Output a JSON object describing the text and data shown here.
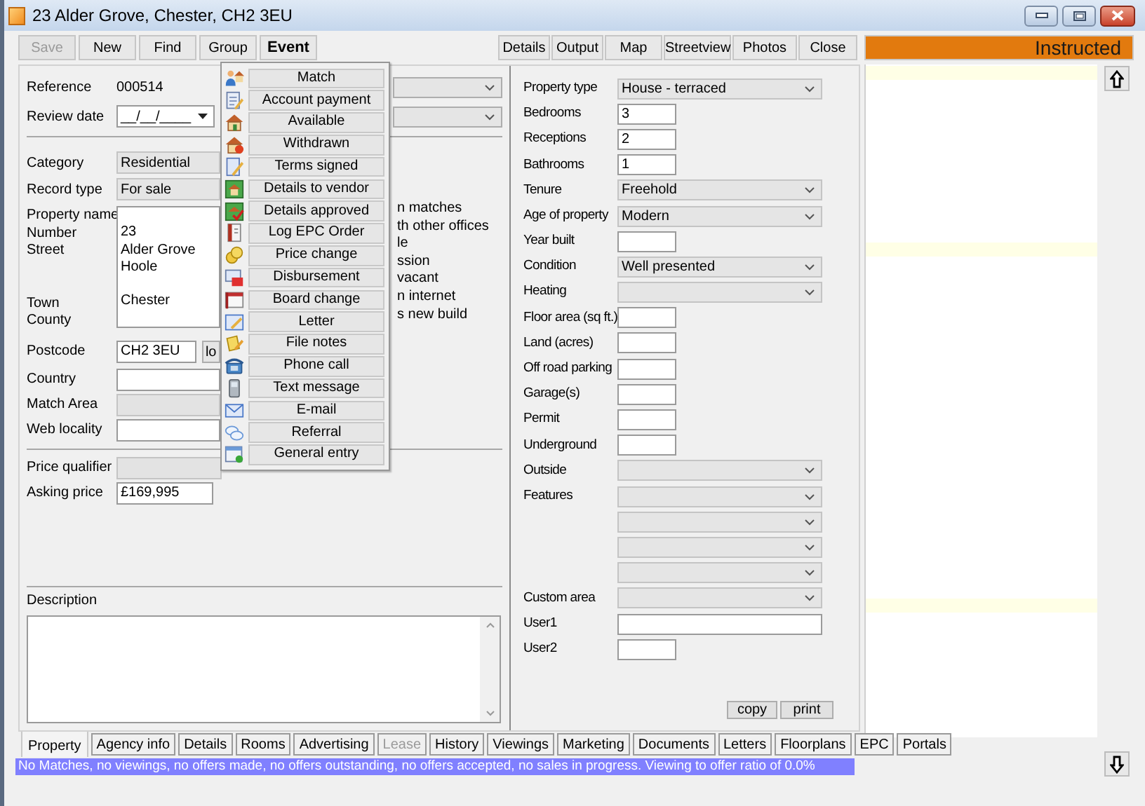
{
  "window": {
    "title": "23 Alder Grove, Chester, CH2 3EU"
  },
  "toolbar": [
    {
      "label": "Save",
      "disabled": true,
      "selected": false
    },
    {
      "label": "New",
      "disabled": false,
      "selected": false
    },
    {
      "label": "Find",
      "disabled": false,
      "selected": false
    },
    {
      "label": "Group",
      "disabled": false,
      "selected": false
    },
    {
      "label": "Event",
      "disabled": false,
      "selected": true
    }
  ],
  "view_buttons": [
    "Details",
    "Output",
    "Map",
    "Streetview",
    "Photos",
    "Close"
  ],
  "status_badge": "Instructed",
  "event_menu": [
    "Match",
    "Account payment",
    "Available",
    "Withdrawn",
    "Terms signed",
    "Details to vendor",
    "Details approved",
    "Log EPC Order",
    "Price change",
    "Disbursement",
    "Board change",
    "Letter",
    "File notes",
    "Phone call",
    "Text message",
    "E-mail",
    "Referral",
    "General entry"
  ],
  "record": {
    "reference": {
      "label": "Reference",
      "value": "000514"
    },
    "review_date": {
      "label": "Review date",
      "value": "__/__/____"
    },
    "category": {
      "label": "Category",
      "value": "Residential"
    },
    "record_type": {
      "label": "Record type",
      "value": "For sale"
    },
    "address": [
      {
        "label": "Property name"
      },
      {
        "label": "Number",
        "value": "23"
      },
      {
        "label": "Street",
        "value": "Alder Grove"
      },
      {
        "value": "Hoole"
      },
      {
        "label": "Town",
        "value": "Chester",
        "gap_before": true
      },
      {
        "label": "County"
      }
    ],
    "postcode": {
      "label": "Postcode",
      "value": "CH2 3EU",
      "button": "lo"
    },
    "country": {
      "label": "Country"
    },
    "match_area": {
      "label": "Match Area",
      "disabled": true
    },
    "web_locality": {
      "label": "Web locality"
    },
    "price_qualifier": {
      "label": "Price qualifier",
      "disabled": true
    },
    "asking_price": {
      "label": "Asking price",
      "value": "£169,995"
    },
    "description": {
      "label": "Description"
    }
  },
  "options_partial": [
    "n matches",
    "th other offices",
    "le",
    "ssion",
    "vacant",
    "n internet",
    "s new build"
  ],
  "details": [
    {
      "kind": "select",
      "label": "Property type",
      "value": "House - terraced"
    },
    {
      "kind": "input",
      "label": "Bedrooms",
      "value": "3"
    },
    {
      "kind": "input",
      "label": "Receptions",
      "value": "2"
    },
    {
      "kind": "input",
      "label": "Bathrooms",
      "value": "1"
    },
    {
      "kind": "select",
      "label": "Tenure",
      "value": "Freehold"
    },
    {
      "kind": "select",
      "label": "Age of property",
      "value": "Modern"
    },
    {
      "kind": "input",
      "label": "Year built"
    },
    {
      "kind": "select",
      "label": "Condition",
      "value": "Well presented"
    },
    {
      "kind": "select",
      "label": "Heating"
    },
    {
      "kind": "input",
      "label": "Floor area (sq ft.)"
    },
    {
      "kind": "input",
      "label": "Land (acres)"
    },
    {
      "kind": "input",
      "label": "Off road parking"
    },
    {
      "kind": "input",
      "label": "Garage(s)"
    },
    {
      "kind": "input",
      "label": "Permit"
    },
    {
      "kind": "input",
      "label": "Underground"
    },
    {
      "kind": "select",
      "label": "Outside"
    },
    {
      "kind": "select",
      "label": "Features"
    },
    {
      "kind": "select"
    },
    {
      "kind": "select"
    },
    {
      "kind": "select"
    },
    {
      "kind": "select",
      "label": "Custom area"
    },
    {
      "kind": "wide_input",
      "label": "User1"
    },
    {
      "kind": "input",
      "label": "User2"
    }
  ],
  "detail_buttons": [
    "copy",
    "print"
  ],
  "tabs": [
    {
      "label": "Property",
      "selected": true,
      "disabled": false
    },
    {
      "label": "Agency info",
      "selected": false,
      "disabled": false
    },
    {
      "label": "Details",
      "selected": false,
      "disabled": false
    },
    {
      "label": "Rooms",
      "selected": false,
      "disabled": false
    },
    {
      "label": "Advertising",
      "selected": false,
      "disabled": false
    },
    {
      "label": "Lease",
      "selected": false,
      "disabled": true
    },
    {
      "label": "History",
      "selected": false,
      "disabled": false
    },
    {
      "label": "Viewings",
      "selected": false,
      "disabled": false
    },
    {
      "label": "Marketing",
      "selected": false,
      "disabled": false
    },
    {
      "label": "Documents",
      "selected": false,
      "disabled": false
    },
    {
      "label": "Letters",
      "selected": false,
      "disabled": false
    },
    {
      "label": "Floorplans",
      "selected": false,
      "disabled": false
    },
    {
      "label": "EPC",
      "selected": false,
      "disabled": false
    },
    {
      "label": "Portals",
      "selected": false,
      "disabled": false
    }
  ],
  "status_bar": "No Matches, no viewings, no offers made, no offers outstanding, no offers accepted, no sales in progress. Viewing to offer ratio of 0.0%"
}
